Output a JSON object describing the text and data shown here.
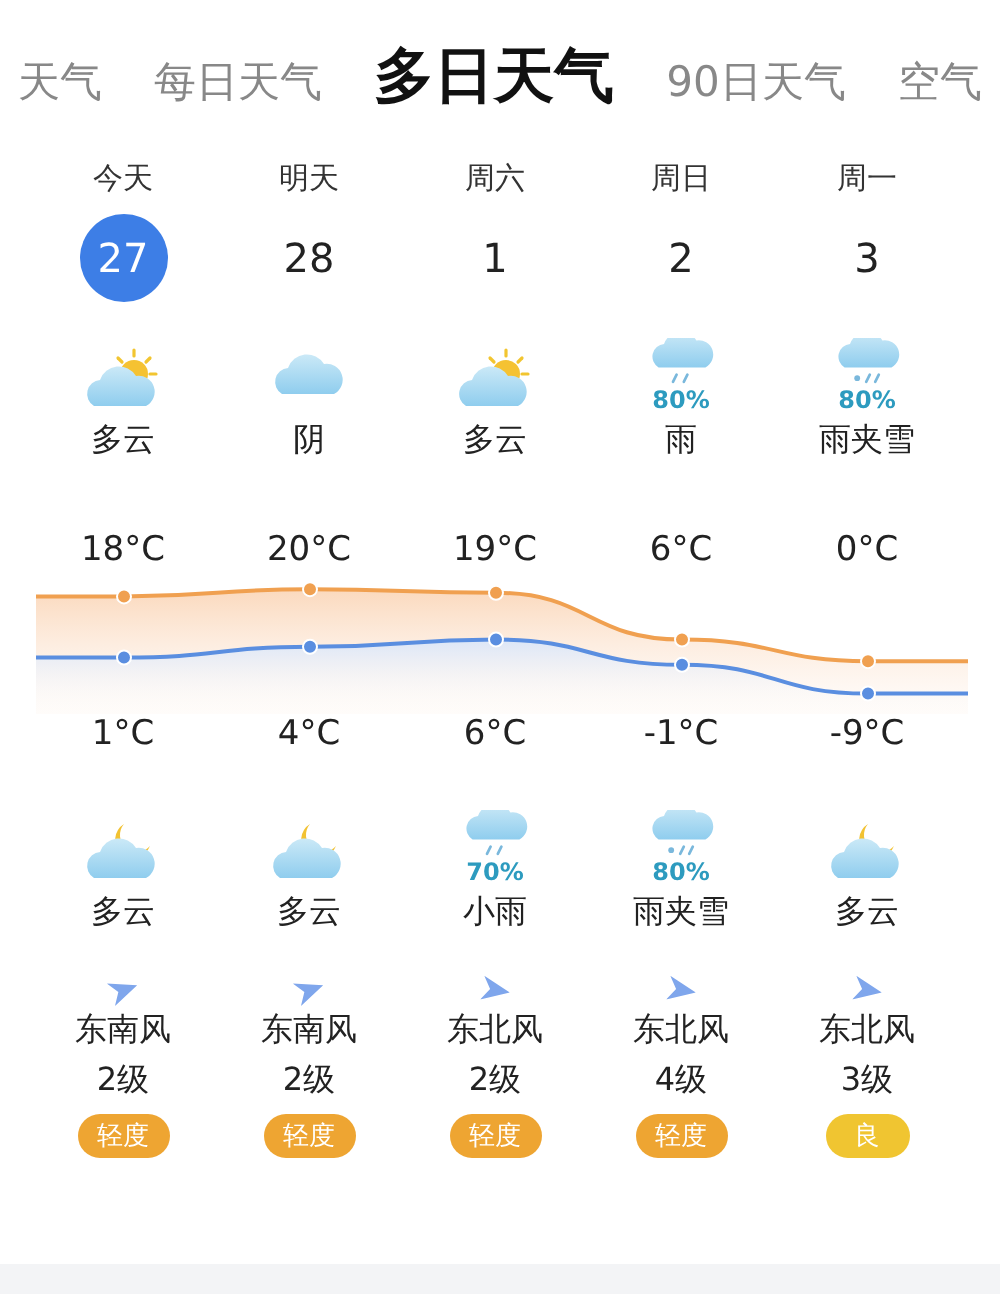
{
  "tabs": [
    {
      "label": "天气",
      "selected": false
    },
    {
      "label": "每日天气",
      "selected": false
    },
    {
      "label": "多日天气",
      "selected": true
    },
    {
      "label": "90日天气",
      "selected": false
    },
    {
      "label": "空气",
      "selected": false
    }
  ],
  "days": [
    {
      "label": "今天",
      "date": "27",
      "selected": true
    },
    {
      "label": "明天",
      "date": "28",
      "selected": false
    },
    {
      "label": "周六",
      "date": "1",
      "selected": false
    },
    {
      "label": "周日",
      "date": "2",
      "selected": false
    },
    {
      "label": "周一",
      "date": "3",
      "selected": false
    }
  ],
  "day_weather": [
    {
      "kind": "sun_cloud",
      "condition": "多云"
    },
    {
      "kind": "cloud",
      "condition": "阴"
    },
    {
      "kind": "sun_cloud",
      "condition": "多云"
    },
    {
      "kind": "rain",
      "precip": "80%",
      "condition": "雨"
    },
    {
      "kind": "sleet",
      "precip": "80%",
      "condition": "雨夹雪"
    }
  ],
  "high_temps": [
    "18°C",
    "20°C",
    "19°C",
    "6°C",
    "0°C"
  ],
  "low_temps": [
    "1°C",
    "4°C",
    "6°C",
    "-1°C",
    "-9°C"
  ],
  "night_weather": [
    {
      "kind": "moon_cloud",
      "condition": "多云"
    },
    {
      "kind": "moon_cloud",
      "condition": "多云"
    },
    {
      "kind": "rain",
      "precip": "70%",
      "condition": "小雨"
    },
    {
      "kind": "sleet",
      "precip": "80%",
      "condition": "雨夹雪"
    },
    {
      "kind": "moon_cloud",
      "condition": "多云"
    }
  ],
  "wind": [
    {
      "kind": "southeast",
      "direction": "东南风",
      "level": "2级",
      "aqi": "轻度",
      "color": "#eea532"
    },
    {
      "kind": "southeast",
      "direction": "东南风",
      "level": "2级",
      "aqi": "轻度",
      "color": "#eea532"
    },
    {
      "kind": "northeast",
      "direction": "东北风",
      "level": "2级",
      "aqi": "轻度",
      "color": "#eea532"
    },
    {
      "kind": "northeast",
      "direction": "东北风",
      "level": "4级",
      "aqi": "轻度",
      "color": "#eea532"
    },
    {
      "kind": "northeast",
      "direction": "东北风",
      "level": "3级",
      "aqi": "良",
      "color": "#f0c531"
    }
  ]
}
